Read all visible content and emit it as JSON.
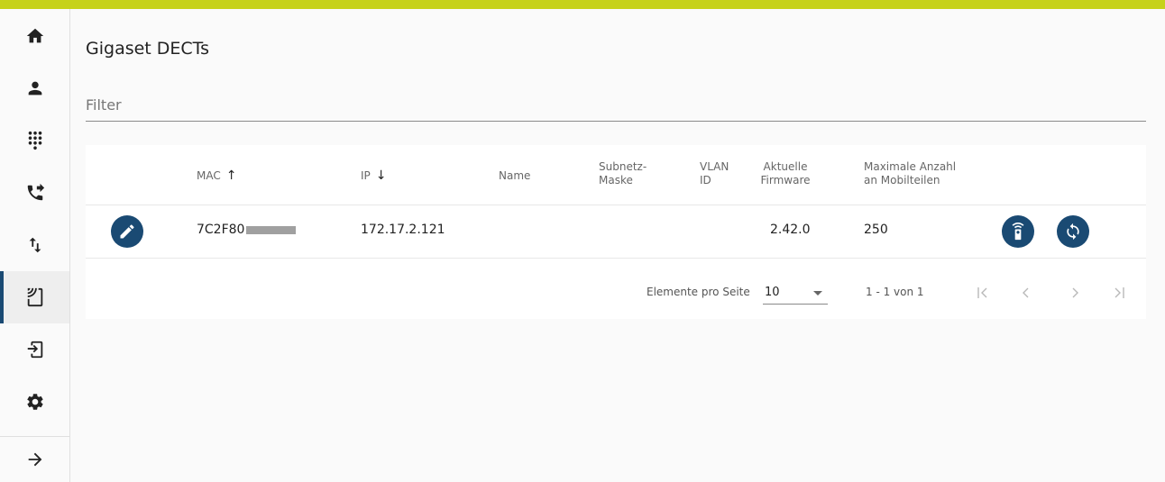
{
  "colors": {
    "accent_bar": "#c6d21a",
    "primary": "#1a4a73",
    "background": "#fafafa"
  },
  "sidebar": {
    "items": [
      {
        "icon": "home-icon"
      },
      {
        "icon": "person-icon"
      },
      {
        "icon": "dialpad-icon"
      },
      {
        "icon": "phone-forward-icon"
      },
      {
        "icon": "swap-vert-icon"
      },
      {
        "icon": "cast-icon",
        "active": true
      },
      {
        "icon": "device-login-icon"
      },
      {
        "icon": "gear-icon"
      },
      {
        "icon": "arrow-right-icon"
      }
    ]
  },
  "main": {
    "title": "Gigaset DECTs",
    "filter_label": "Filter",
    "table": {
      "columns": [
        {
          "label": "MAC",
          "sort": "asc"
        },
        {
          "label": "IP",
          "sort": "desc"
        },
        {
          "label": "Name"
        },
        {
          "label": "Subnetz-\nMaske"
        },
        {
          "label": "VLAN\nID"
        },
        {
          "label": "Aktuelle\nFirmware"
        },
        {
          "label": "Maximale Anzahl\nan Mobilteilen"
        }
      ],
      "rows": [
        {
          "mac": "7C2F80",
          "ip": "172.17.2.121",
          "name": "",
          "subnet": "",
          "vlan": "",
          "firmware": "2.42.0",
          "max_handsets": "250"
        }
      ]
    },
    "pagination": {
      "items_per_page_label": "Elemente pro Seite",
      "items_per_page_value": "10",
      "range_label": "1 - 1 von 1"
    }
  }
}
